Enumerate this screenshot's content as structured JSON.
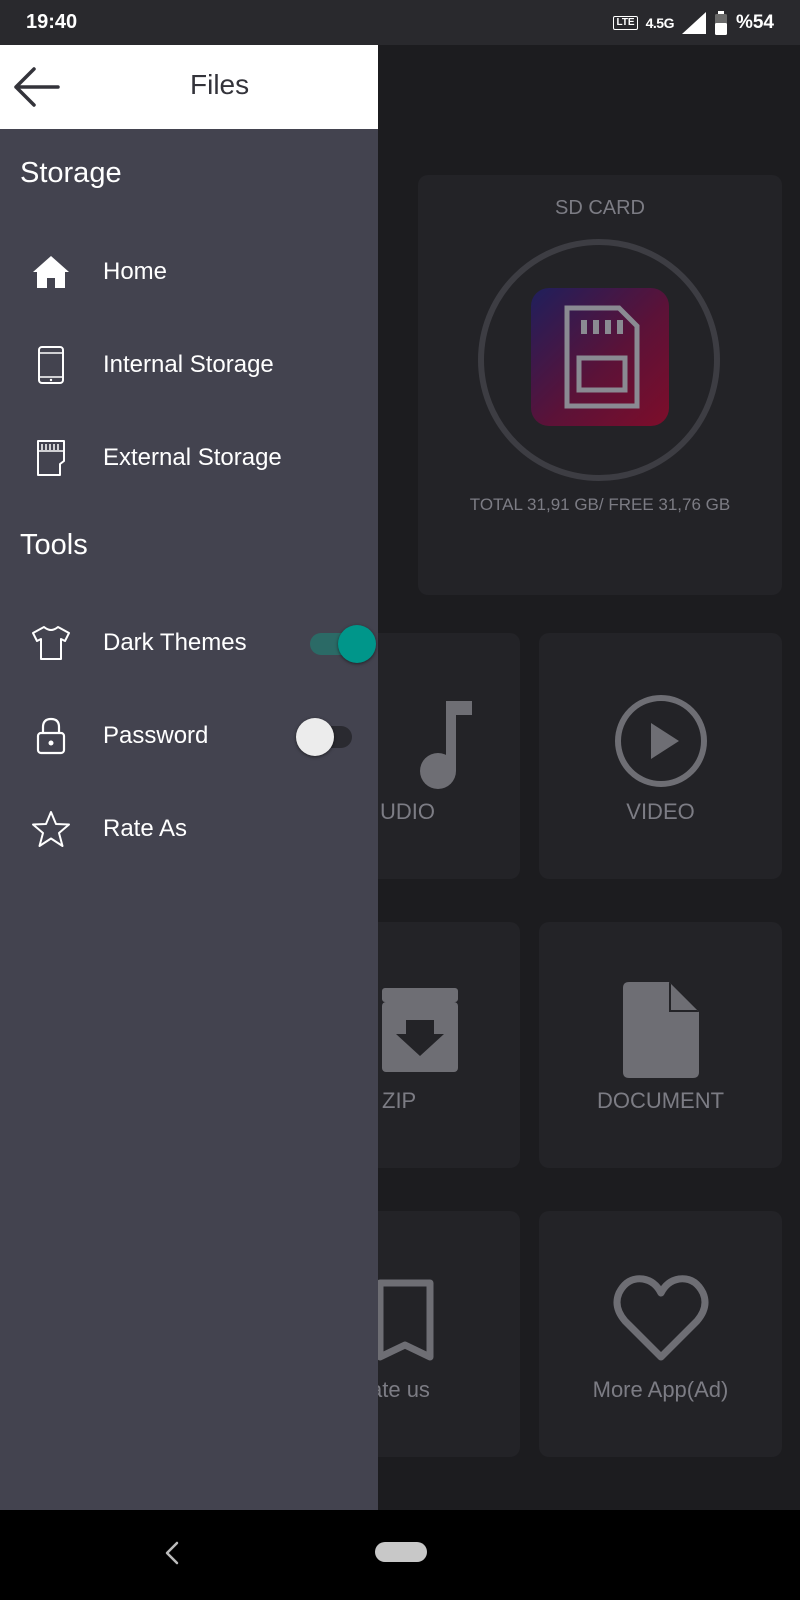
{
  "status_bar": {
    "time": "19:40",
    "network_badge": "LTE",
    "network_type": "4.5G",
    "battery": "%54"
  },
  "drawer": {
    "title": "Files",
    "sections": {
      "storage": "Storage",
      "tools": "Tools"
    },
    "storage_items": [
      {
        "label": "Home",
        "icon": "home-icon"
      },
      {
        "label": "Internal Storage",
        "icon": "phone-icon"
      },
      {
        "label": "External Storage",
        "icon": "sd-card-icon"
      }
    ],
    "tool_items": [
      {
        "label": "Dark Themes",
        "icon": "tshirt-icon",
        "toggle": true
      },
      {
        "label": "Password",
        "icon": "lock-icon",
        "toggle": false
      },
      {
        "label": "Rate As",
        "icon": "star-icon"
      }
    ]
  },
  "background": {
    "sd_card": {
      "label": "SD CARD",
      "info": "TOTAL 31,91 GB/ FREE 31,76 GB"
    },
    "tiles": [
      {
        "label": "UDIO",
        "icon": "music-note-icon"
      },
      {
        "label": "VIDEO",
        "icon": "play-circle-icon"
      },
      {
        "label": "ZIP",
        "icon": "archive-icon"
      },
      {
        "label": "DOCUMENT",
        "icon": "document-icon"
      },
      {
        "label": "ate us",
        "icon": "bookmark-icon"
      },
      {
        "label": "More App(Ad)",
        "icon": "heart-icon"
      }
    ]
  },
  "colors": {
    "drawer_bg": "#43434f",
    "accent_toggle": "#00968a",
    "app_bg": "#1c1c1f"
  }
}
